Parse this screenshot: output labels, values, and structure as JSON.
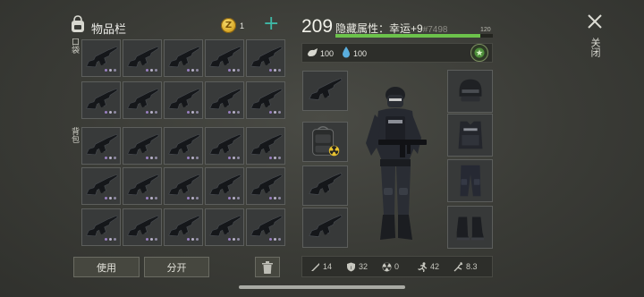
{
  "inventory": {
    "title": "物品栏",
    "coin_symbol": "Z",
    "coin_count": "1",
    "add_label": "+",
    "section_pocket": "口袋",
    "section_backpack": "背包",
    "item_icon": "assault-rifle-icon",
    "use_label": "使用",
    "split_label": "分开"
  },
  "player": {
    "level": "209",
    "hidden_attr": "隐藏属性：幸运+9",
    "attr_id": "#7498",
    "xp_max": "120",
    "xp_fraction": 0.92,
    "food": "100",
    "water": "100"
  },
  "bottom_stats": {
    "attack": "14",
    "defense": "32",
    "radiation": "0",
    "speed": "42",
    "stealth": "8.3"
  },
  "close_label": "关闭",
  "colors": {
    "accent_teal": "#3fb8a6",
    "xp_green": "#6cc24b",
    "rarity_purple": "#9a80c2"
  }
}
